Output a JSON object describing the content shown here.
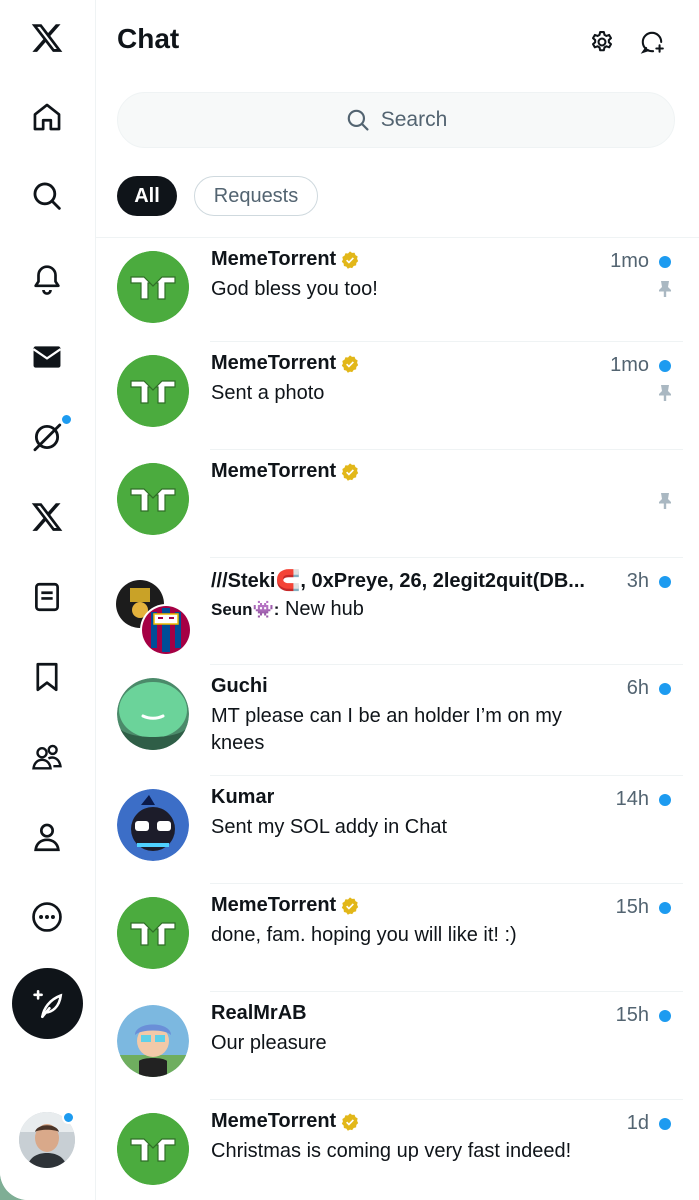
{
  "header": {
    "title": "Chat",
    "search_placeholder": "Search"
  },
  "filters": [
    {
      "label": "All",
      "active": true
    },
    {
      "label": "Requests",
      "active": false
    }
  ],
  "nav": [
    {
      "name": "x-logo-icon"
    },
    {
      "name": "home-icon"
    },
    {
      "name": "explore-icon"
    },
    {
      "name": "notifications-icon"
    },
    {
      "name": "messages-icon"
    },
    {
      "name": "grok-icon",
      "has_dot": true
    },
    {
      "name": "premium-x-icon"
    },
    {
      "name": "lists-icon"
    },
    {
      "name": "bookmarks-icon"
    },
    {
      "name": "communities-icon"
    },
    {
      "name": "profile-icon"
    },
    {
      "name": "more-icon"
    }
  ],
  "colors": {
    "accent": "#1d9bf0",
    "verified": "#e2b719",
    "memetorrent_green": "#4bab3e"
  },
  "conversations": [
    {
      "name": "MemeTorrent",
      "verified": true,
      "preview": "God bless you too!",
      "time": "1mo",
      "unread": true,
      "pinned": true,
      "avatar": "mt-logo"
    },
    {
      "name": "MemeTorrent",
      "verified": true,
      "preview": "Sent a photo",
      "time": "1mo",
      "unread": true,
      "pinned": true,
      "avatar": "mt-logo"
    },
    {
      "name": "MemeTorrent",
      "verified": true,
      "preview": "",
      "time": "",
      "unread": false,
      "pinned": true,
      "avatar": "mt-logo"
    },
    {
      "name": "///Steki🧲, 0xPreye, 26, 2legit2quit(DB...",
      "verified": false,
      "sender": "Seun👾:",
      "preview": "New hub",
      "time": "3h",
      "unread": true,
      "pinned": false,
      "avatar": "group"
    },
    {
      "name": "Guchi",
      "verified": false,
      "preview": "MT please can I be an holder I’m on my knees",
      "time": "6h",
      "unread": true,
      "pinned": false,
      "avatar": "guchi"
    },
    {
      "name": "Kumar",
      "verified": false,
      "preview": "Sent my SOL addy in Chat",
      "time": "14h",
      "unread": true,
      "pinned": false,
      "avatar": "kumar"
    },
    {
      "name": "MemeTorrent",
      "verified": true,
      "preview": "done, fam. hoping you will like it! :)",
      "time": "15h",
      "unread": true,
      "pinned": false,
      "avatar": "mt-logo"
    },
    {
      "name": "RealMrAB",
      "verified": false,
      "preview": "Our pleasure",
      "time": "15h",
      "unread": true,
      "pinned": false,
      "avatar": "realmrab"
    },
    {
      "name": "MemeTorrent",
      "verified": true,
      "preview": "Christmas is coming up very fast indeed!",
      "time": "1d",
      "unread": true,
      "pinned": false,
      "avatar": "mt-logo"
    }
  ]
}
